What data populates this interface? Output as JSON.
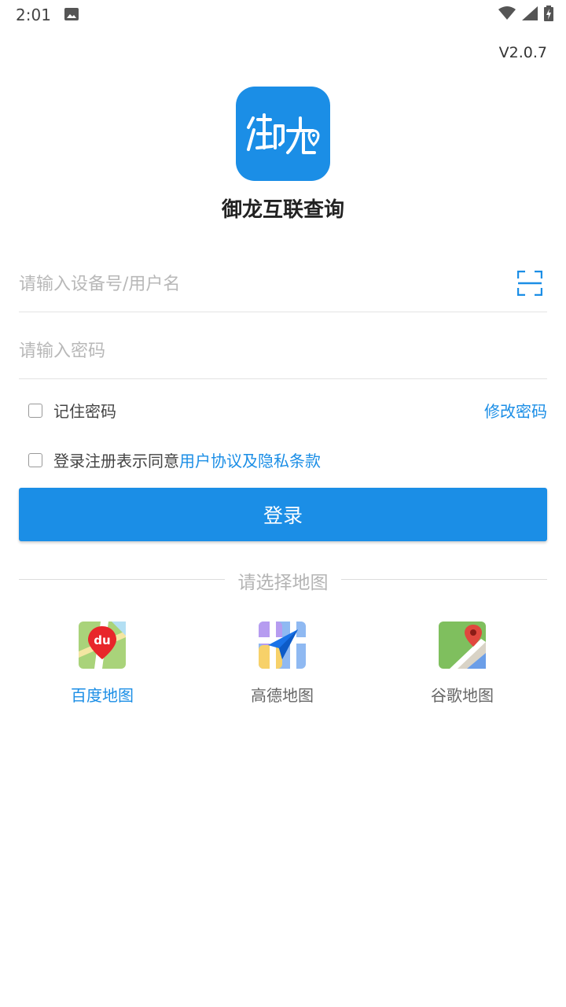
{
  "status_bar": {
    "time": "2:01"
  },
  "version": "V2.0.7",
  "app": {
    "name": "御龙互联查询",
    "brand_color": "#1b8ee6"
  },
  "login_form": {
    "username_placeholder": "请输入设备号/用户名",
    "password_placeholder": "请输入密码",
    "remember_label": "记住密码",
    "change_password_link": "修改密码",
    "agreement_prefix": "登录注册表示同意",
    "agreement_link": "用户协议及隐私条款",
    "login_button": "登录"
  },
  "map_section": {
    "title": "请选择地图",
    "options": [
      {
        "label": "百度地图",
        "icon": "baidu-map-icon",
        "selected": true
      },
      {
        "label": "高德地图",
        "icon": "amap-icon",
        "selected": false
      },
      {
        "label": "谷歌地图",
        "icon": "google-maps-icon",
        "selected": false
      }
    ]
  }
}
